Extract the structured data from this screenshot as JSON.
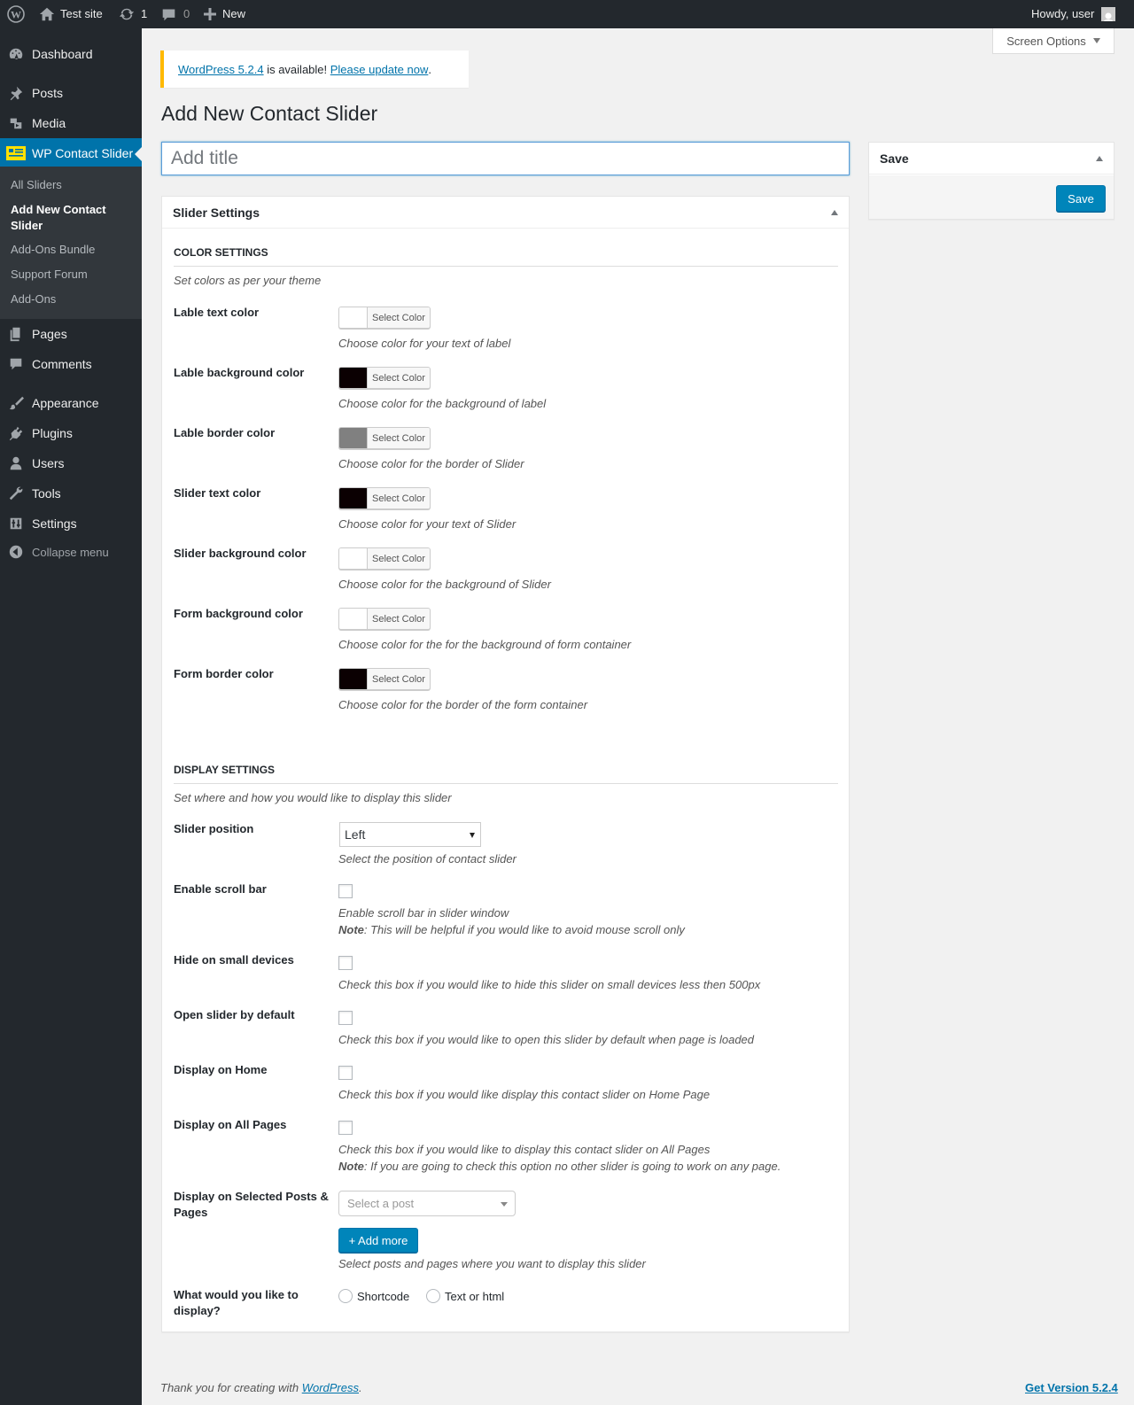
{
  "admin_bar": {
    "site_name": "Test site",
    "updates_count": "1",
    "comments_count": "0",
    "new_label": "New",
    "howdy": "Howdy, user"
  },
  "sidebar": {
    "items": [
      {
        "label": "Dashboard",
        "icon": "dashboard-icon"
      },
      {
        "label": "Posts",
        "icon": "pin-icon"
      },
      {
        "label": "Media",
        "icon": "media-icon"
      },
      {
        "label": "WP Contact Slider",
        "icon": "contact-slider-icon"
      },
      {
        "label": "Pages",
        "icon": "pages-icon"
      },
      {
        "label": "Comments",
        "icon": "comment-icon"
      },
      {
        "label": "Appearance",
        "icon": "brush-icon"
      },
      {
        "label": "Plugins",
        "icon": "plugin-icon"
      },
      {
        "label": "Users",
        "icon": "user-icon"
      },
      {
        "label": "Tools",
        "icon": "wrench-icon"
      },
      {
        "label": "Settings",
        "icon": "settings-icon"
      }
    ],
    "submenu": [
      "All Sliders",
      "Add New Contact Slider",
      "Add-Ons Bundle",
      "Support Forum",
      "Add-Ons"
    ],
    "collapse": "Collapse menu",
    "accent": "#0073aa"
  },
  "screen_options": "Screen Options",
  "notice": {
    "link1": "WordPress 5.2.4",
    "text": " is available! ",
    "link2": "Please update now",
    "end": "."
  },
  "page_title": "Add New Contact Slider",
  "title_placeholder": "Add title",
  "slider_settings": {
    "heading": "Slider Settings",
    "color_section": {
      "title": "COLOR SETTINGS",
      "desc": "Set colors as per your theme",
      "button_label": "Select Color",
      "fields": [
        {
          "label": "Lable text color",
          "color": "#ffffff",
          "help": "Choose color for your text of label"
        },
        {
          "label": "Lable background color",
          "color": "#0b0002",
          "help": "Choose color for the background of label"
        },
        {
          "label": "Lable border color",
          "color": "#808080",
          "help": "Choose color for the border of Slider"
        },
        {
          "label": "Slider text color",
          "color": "#0b0002",
          "help": "Choose color for your text of Slider"
        },
        {
          "label": "Slider background color",
          "color": "#ffffff",
          "help": "Choose color for the background of Slider"
        },
        {
          "label": "Form background color",
          "color": "#ffffff",
          "help": "Choose color for the for the background of form container"
        },
        {
          "label": "Form border color",
          "color": "#0b0002",
          "help": "Choose color for the border of the form container"
        }
      ]
    },
    "display_section": {
      "title": "DISPLAY SETTINGS",
      "desc": "Set where and how you would like to display this slider",
      "slider_position": {
        "label": "Slider position",
        "value": "Left",
        "help": "Select the position of contact slider"
      },
      "scroll_bar": {
        "label": "Enable scroll bar",
        "help": "Enable scroll bar in slider window",
        "note_label": "Note",
        "note": ": This will be helpful if you would like to avoid mouse scroll only"
      },
      "hide_small": {
        "label": "Hide on small devices",
        "help": "Check this box if you would like to hide this slider on small devices less then 500px"
      },
      "open_default": {
        "label": "Open slider by default",
        "help": "Check this box if you would like to open this slider by default when page is loaded"
      },
      "display_home": {
        "label": "Display on Home",
        "help": "Check this box if you would like display this contact slider on Home Page"
      },
      "display_all": {
        "label": "Display on All Pages",
        "help": "Check this box if you would like to display this contact slider on All Pages",
        "note_label": "Note",
        "note": ": If you are going to check this option no other slider is going to work on any page."
      },
      "selected_posts": {
        "label": "Display on Selected Posts & Pages",
        "placeholder": "Select a post",
        "add_more": "+ Add more",
        "help": "Select posts and pages where you want to display this slider"
      },
      "display_what": {
        "label": "What would you like to display?",
        "options": [
          "Shortcode",
          "Text or html"
        ]
      }
    }
  },
  "save_box": {
    "heading": "Save",
    "button": "Save"
  },
  "footer": {
    "thanks": "Thank you for creating with ",
    "wp_link": "WordPress",
    "end": ".",
    "version_link": "Get Version 5.2.4"
  }
}
